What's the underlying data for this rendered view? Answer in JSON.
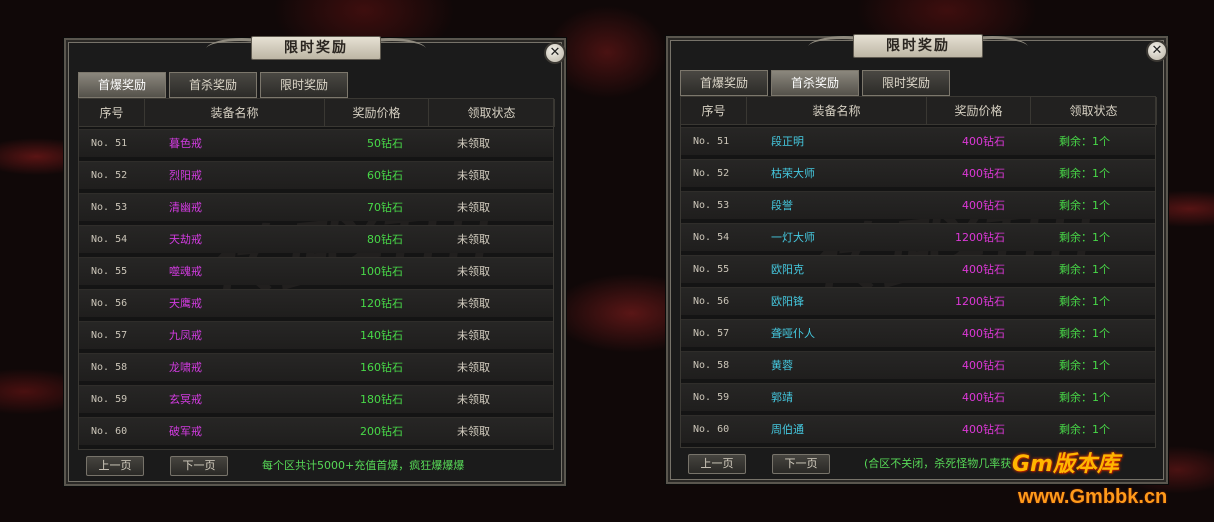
{
  "colors": {
    "name_purple": "#d23be0",
    "name_cyan": "#45c9e0",
    "price_green": "#48d948",
    "price_magenta": "#dd38d8",
    "status_white": "#d4cec0",
    "status_green": "#48d948"
  },
  "left_panel": {
    "title": "限时奖励",
    "close_icon": "close-icon",
    "tabs": [
      {
        "label": "首爆奖励",
        "active": true
      },
      {
        "label": "首杀奖励",
        "active": false
      },
      {
        "label": "限时奖励",
        "active": false
      }
    ],
    "columns": [
      "序号",
      "装备名称",
      "奖励价格",
      "领取状态"
    ],
    "rows": [
      {
        "no": "No. 51",
        "name": "暮色戒",
        "price": "50钻石",
        "status": "未领取"
      },
      {
        "no": "No. 52",
        "name": "烈阳戒",
        "price": "60钻石",
        "status": "未领取"
      },
      {
        "no": "No. 53",
        "name": "清幽戒",
        "price": "70钻石",
        "status": "未领取"
      },
      {
        "no": "No. 54",
        "name": "天劫戒",
        "price": "80钻石",
        "status": "未领取"
      },
      {
        "no": "No. 55",
        "name": "噬魂戒",
        "price": "100钻石",
        "status": "未领取"
      },
      {
        "no": "No. 56",
        "name": "天鹰戒",
        "price": "120钻石",
        "status": "未领取"
      },
      {
        "no": "No. 57",
        "name": "九凤戒",
        "price": "140钻石",
        "status": "未领取"
      },
      {
        "no": "No. 58",
        "name": "龙啸戒",
        "price": "160钻石",
        "status": "未领取"
      },
      {
        "no": "No. 59",
        "name": "玄冥戒",
        "price": "180钻石",
        "status": "未领取"
      },
      {
        "no": "No. 60",
        "name": "破军戒",
        "price": "200钻石",
        "status": "未领取"
      }
    ],
    "prev_label": "上一页",
    "next_label": "下一页",
    "note": "每个区共计5000+充值首爆，疯狂爆爆爆"
  },
  "right_panel": {
    "title": "限时奖励",
    "close_icon": "close-icon",
    "tabs": [
      {
        "label": "首爆奖励",
        "active": false
      },
      {
        "label": "首杀奖励",
        "active": true
      },
      {
        "label": "限时奖励",
        "active": false
      }
    ],
    "columns": [
      "序号",
      "装备名称",
      "奖励价格",
      "领取状态"
    ],
    "rows": [
      {
        "no": "No. 51",
        "name": "段正明",
        "price": "400钻石",
        "status": "剩余：1个"
      },
      {
        "no": "No. 52",
        "name": "枯荣大师",
        "price": "400钻石",
        "status": "剩余：1个"
      },
      {
        "no": "No. 53",
        "name": "段誉",
        "price": "400钻石",
        "status": "剩余：1个"
      },
      {
        "no": "No. 54",
        "name": "一灯大师",
        "price": "1200钻石",
        "status": "剩余：1个"
      },
      {
        "no": "No. 55",
        "name": "欧阳克",
        "price": "400钻石",
        "status": "剩余：1个"
      },
      {
        "no": "No. 56",
        "name": "欧阳锋",
        "price": "1200钻石",
        "status": "剩余：1个"
      },
      {
        "no": "No. 57",
        "name": "聋哑仆人",
        "price": "400钻石",
        "status": "剩余：1个"
      },
      {
        "no": "No. 58",
        "name": "黄蓉",
        "price": "400钻石",
        "status": "剩余：1个"
      },
      {
        "no": "No. 59",
        "name": "郭靖",
        "price": "400钻石",
        "status": "剩余：1个"
      },
      {
        "no": "No. 60",
        "name": "周伯通",
        "price": "400钻石",
        "status": "剩余：1个"
      }
    ],
    "prev_label": "上一页",
    "next_label": "下一页",
    "note": "(合区不关闭，杀死怪物几率获"
  },
  "watermark": {
    "text": "传武红山"
  },
  "brand": {
    "logo": "Gm版本库",
    "url": "www.Gmbbk.cn"
  }
}
